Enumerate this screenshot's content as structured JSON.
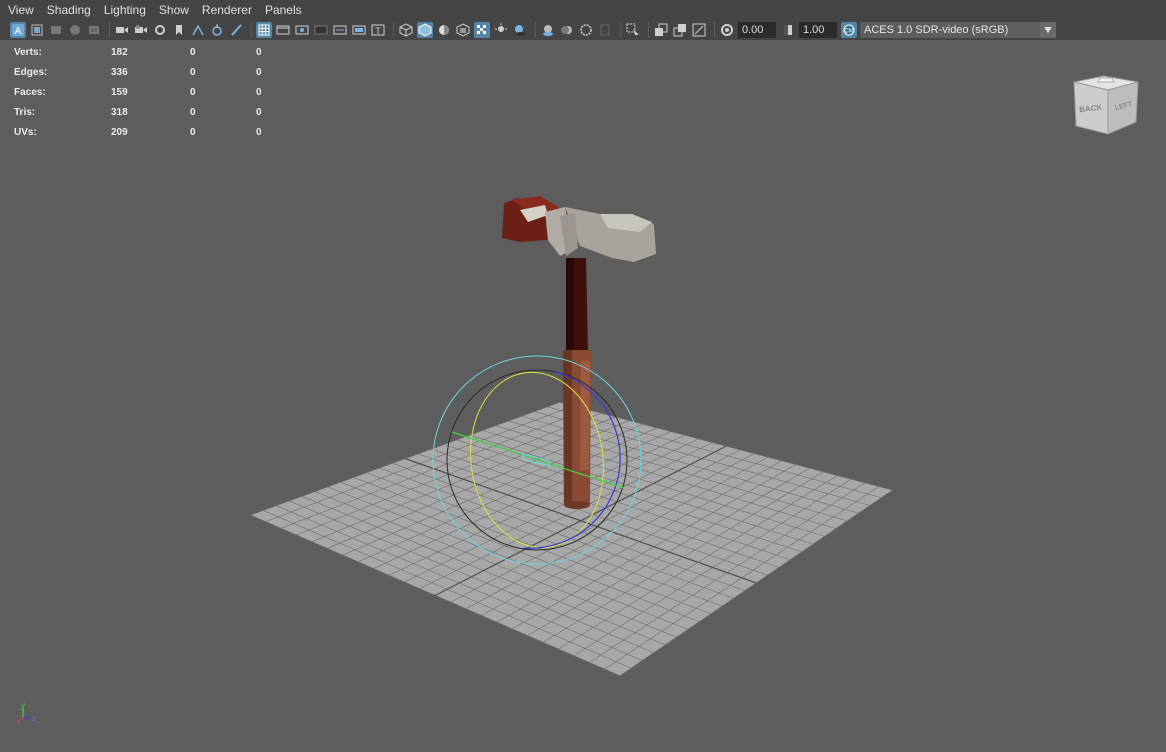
{
  "menu": {
    "items": [
      "View",
      "Shading",
      "Lighting",
      "Show",
      "Renderer",
      "Panels"
    ]
  },
  "toolbar": {
    "exposure": "0.00",
    "gamma": "1.00",
    "color_space": "ACES 1.0 SDR-video (sRGB)",
    "icons": [
      "select-camera",
      "camera-attributes",
      "bookmarks",
      "image-plane",
      "view-2d-pan",
      "camera-lock",
      "film-gate",
      "resolution-gate",
      "gate-mask",
      "field-chart",
      "safe-action",
      "safe-title",
      "wireframe",
      "smooth-shade",
      "smooth-shade-wireframe",
      "flat-shade",
      "textured",
      "lights",
      "shadows",
      "ambient-occlusion",
      "motion-blur",
      "anti-aliasing",
      "depth-of-field",
      "isolate-select",
      "xray",
      "xray-joints",
      "xray-components",
      "exposure",
      "gamma",
      "color-management"
    ]
  },
  "hud": {
    "rows": [
      {
        "label": "Verts:",
        "v1": "182",
        "v2": "0",
        "v3": "0"
      },
      {
        "label": "Edges:",
        "v1": "336",
        "v2": "0",
        "v3": "0"
      },
      {
        "label": "Faces:",
        "v1": "159",
        "v2": "0",
        "v3": "0"
      },
      {
        "label": "Tris:",
        "v1": "318",
        "v2": "0",
        "v3": "0"
      },
      {
        "label": "UVs:",
        "v1": "209",
        "v2": "0",
        "v3": "0"
      }
    ]
  },
  "viewcube": {
    "face_back": "BACK",
    "face_left": "LEFT"
  },
  "axis": {
    "y": "y",
    "z": "z"
  },
  "colors": {
    "ui_bg": "#444444",
    "viewport_bg": "#5d5d5d",
    "accent": "#5285a6",
    "grid_plane": "#a8a8a8",
    "handle_color": "#7a3a22",
    "rotate_x": "#3a3ad6",
    "rotate_y": "#e0e040",
    "rotate_z": "#40d040",
    "rotate_outer": "#6ad6e0"
  }
}
